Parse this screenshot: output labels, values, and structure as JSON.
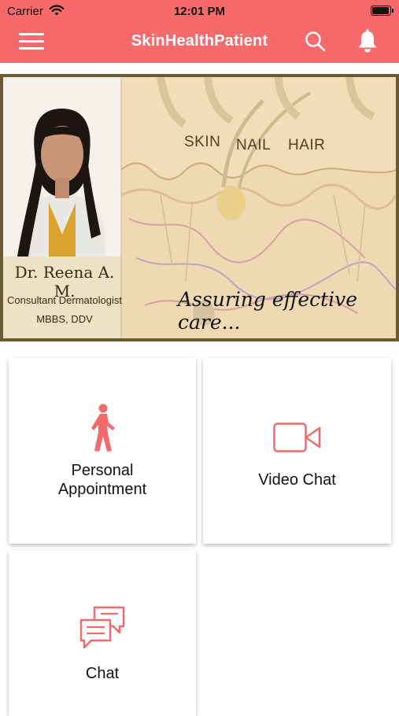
{
  "status_bar": {
    "carrier": "Carrier",
    "time": "12:01 PM",
    "battery_level": 1.0
  },
  "navbar": {
    "title": "SkinHealthPatient",
    "menu_icon": "hamburger-menu-icon",
    "search_icon": "search-icon",
    "notification_icon": "bell-icon",
    "background_color": "#f66a6c"
  },
  "banner": {
    "doctor_name": "Dr. Reena A. M.",
    "doctor_role": "Consultant Dermatologist",
    "doctor_degrees": "MBBS, DDV",
    "label_skin": "SKIN",
    "label_nail": "NAIL",
    "label_hair": "HAIR",
    "tagline": "Assuring effective care..."
  },
  "tiles": [
    {
      "label_line1": "Personal",
      "label_line2": "Appointment",
      "icon": "walking-person-icon"
    },
    {
      "label": "Video Chat",
      "icon": "video-camera-icon"
    },
    {
      "label": "Chat",
      "icon": "chat-bubbles-icon"
    }
  ],
  "accent_color": "#f26a6a"
}
